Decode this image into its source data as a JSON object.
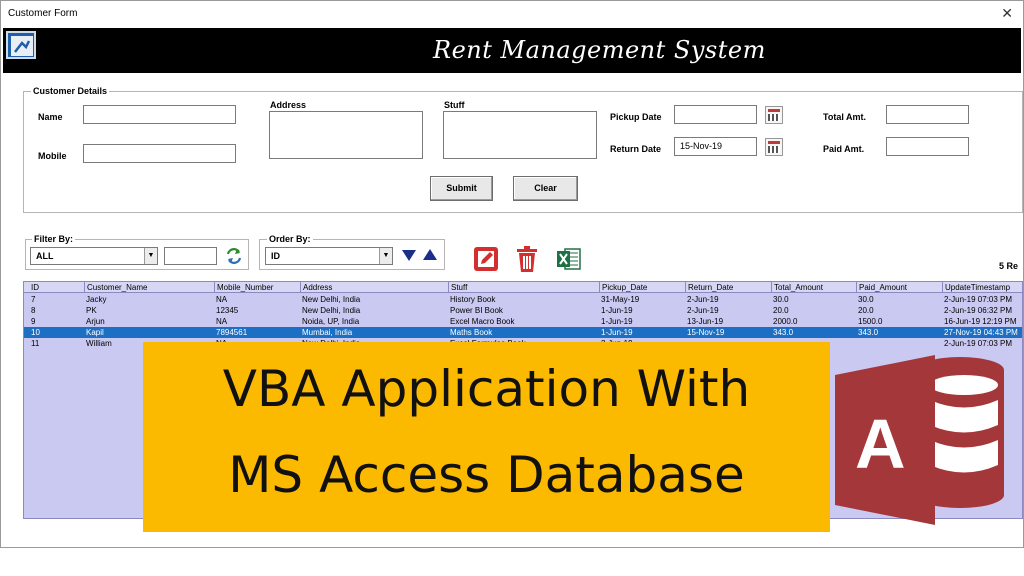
{
  "window": {
    "title": "Customer Form",
    "close_glyph": "✕"
  },
  "header": {
    "app_title": "Rent Management System",
    "logo_icon": "app-logo-icon"
  },
  "customer_details": {
    "legend": "Customer Details",
    "name_label": "Name",
    "name_value": "",
    "mobile_label": "Mobile",
    "mobile_value": "",
    "address_label": "Address",
    "address_value": "",
    "stuff_label": "Stuff",
    "stuff_value": "",
    "pickup_label": "Pickup Date",
    "pickup_value": "",
    "return_label": "Return Date",
    "return_value": "15-Nov-19",
    "total_label": "Total Amt.",
    "total_value": "",
    "paid_label": "Paid Amt.",
    "paid_value": "",
    "submit_label": "Submit",
    "clear_label": "Clear"
  },
  "filter": {
    "legend": "Filter By:",
    "selected": "ALL",
    "search_value": ""
  },
  "order": {
    "legend": "Order By:",
    "selected": "ID"
  },
  "toolbar": {
    "icons": [
      "edit-icon",
      "delete-icon",
      "excel-icon"
    ]
  },
  "records_count": "5 Re",
  "table": {
    "columns": [
      "ID",
      "Customer_Name",
      "Mobile_Number",
      "Address",
      "Stuff",
      "Pickup_Date",
      "Return_Date",
      "Total_Amount",
      "Paid_Amount",
      "UpdateTimestamp"
    ],
    "rows": [
      [
        "7",
        "Jacky",
        "NA",
        "New Delhi, India",
        "History Book",
        "31-May-19",
        "2-Jun-19",
        "30.0",
        "30.0",
        "2-Jun-19 07:03 PM"
      ],
      [
        "8",
        "PK",
        "12345",
        "New Delhi, India",
        "Power BI Book",
        "1-Jun-19",
        "2-Jun-19",
        "20.0",
        "20.0",
        "2-Jun-19 06:32 PM"
      ],
      [
        "9",
        "Arjun",
        "NA",
        "Noida, UP, India",
        "Excel Macro Book",
        "1-Jun-19",
        "13-Jun-19",
        "2000.0",
        "1500.0",
        "16-Jun-19 12:19 PM"
      ],
      [
        "10",
        "Kapil",
        "7894561",
        "Mumbai, India",
        "Maths Book",
        "1-Jun-19",
        "15-Nov-19",
        "343.0",
        "343.0",
        "27-Nov-19 04:43 PM"
      ],
      [
        "11",
        "William",
        "NA",
        "New Delhi, India",
        "Excel Formulas Book",
        "2-Jun-19",
        "",
        "",
        "",
        "2-Jun-19 07:03 PM"
      ]
    ],
    "selected_row_index": 3
  },
  "overlay": {
    "line1": "VBA Application With",
    "line2": "MS Access Database",
    "color": "#fbb900",
    "logo_icon": "ms-access-icon",
    "logo_letter": "A"
  }
}
